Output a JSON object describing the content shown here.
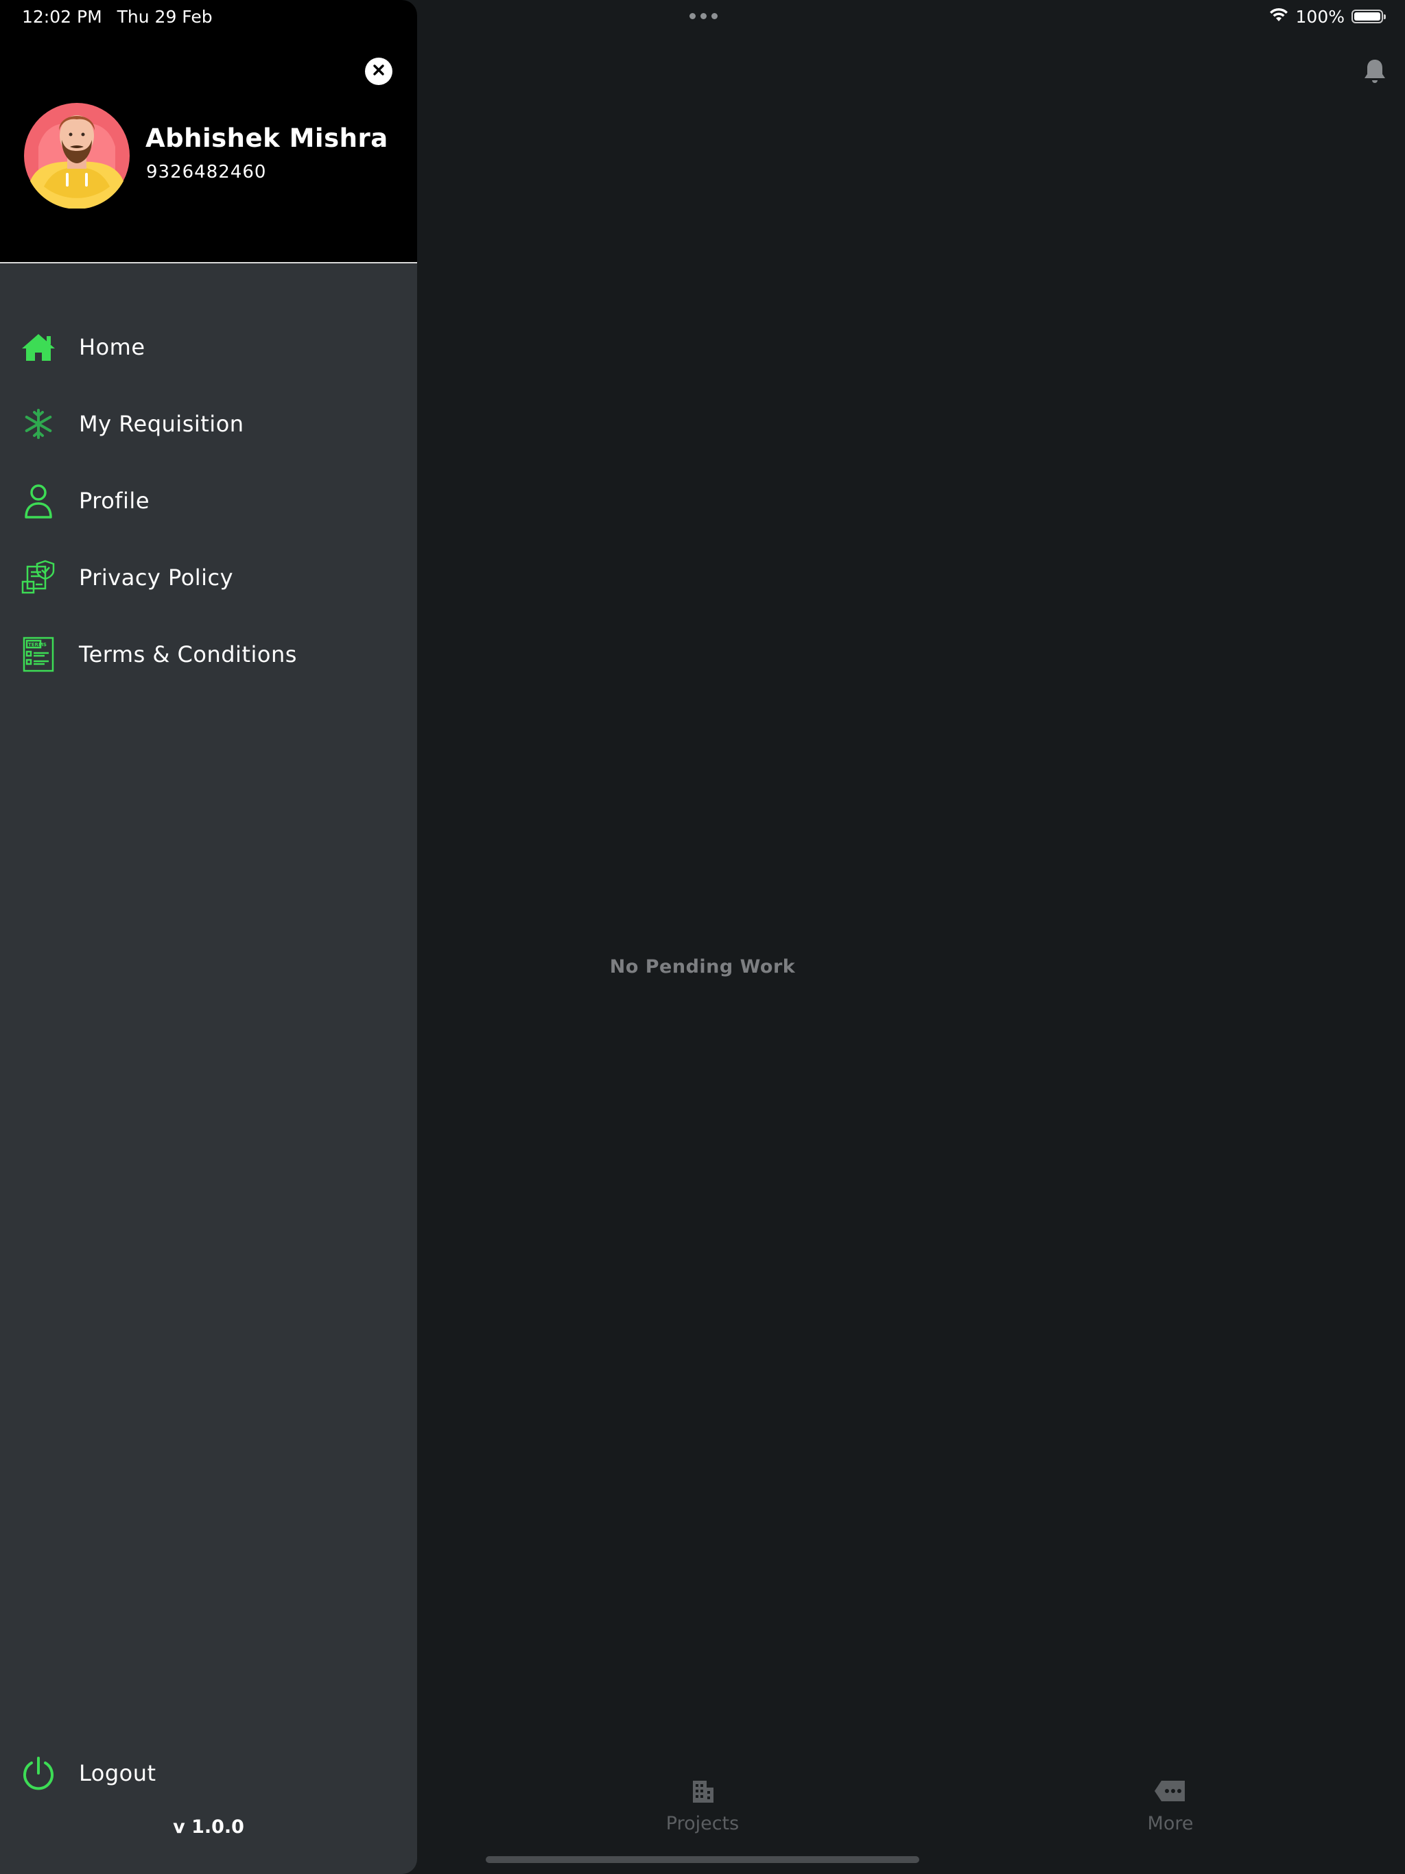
{
  "status_bar": {
    "time": "12:02 PM",
    "date": "Thu 29 Feb",
    "battery": "100%",
    "icons": [
      "wifi-icon",
      "battery-icon"
    ]
  },
  "drawer": {
    "user": {
      "name": "Abhishek Mishra",
      "phone": "9326482460"
    },
    "menu": [
      {
        "label": "Home",
        "icon": "home-icon"
      },
      {
        "label": "My Requisition",
        "icon": "snowflake-icon"
      },
      {
        "label": "Profile",
        "icon": "user-icon"
      },
      {
        "label": "Privacy Policy",
        "icon": "privacy-document-icon"
      },
      {
        "label": "Terms & Conditions",
        "icon": "terms-document-icon"
      }
    ],
    "logout": {
      "label": "Logout",
      "icon": "power-icon"
    },
    "version": "v 1.0.0"
  },
  "main": {
    "empty_message": "No Pending Work",
    "tabs": [
      {
        "label": "Projects",
        "icon": "building-icon"
      },
      {
        "label": "More",
        "icon": "more-tag-icon"
      }
    ]
  },
  "colors": {
    "accent": "#3ddc55",
    "drawer_bg": "#303438",
    "header_bg": "#000000",
    "main_bg": "#171a1c",
    "muted_text": "#7d7f82"
  }
}
